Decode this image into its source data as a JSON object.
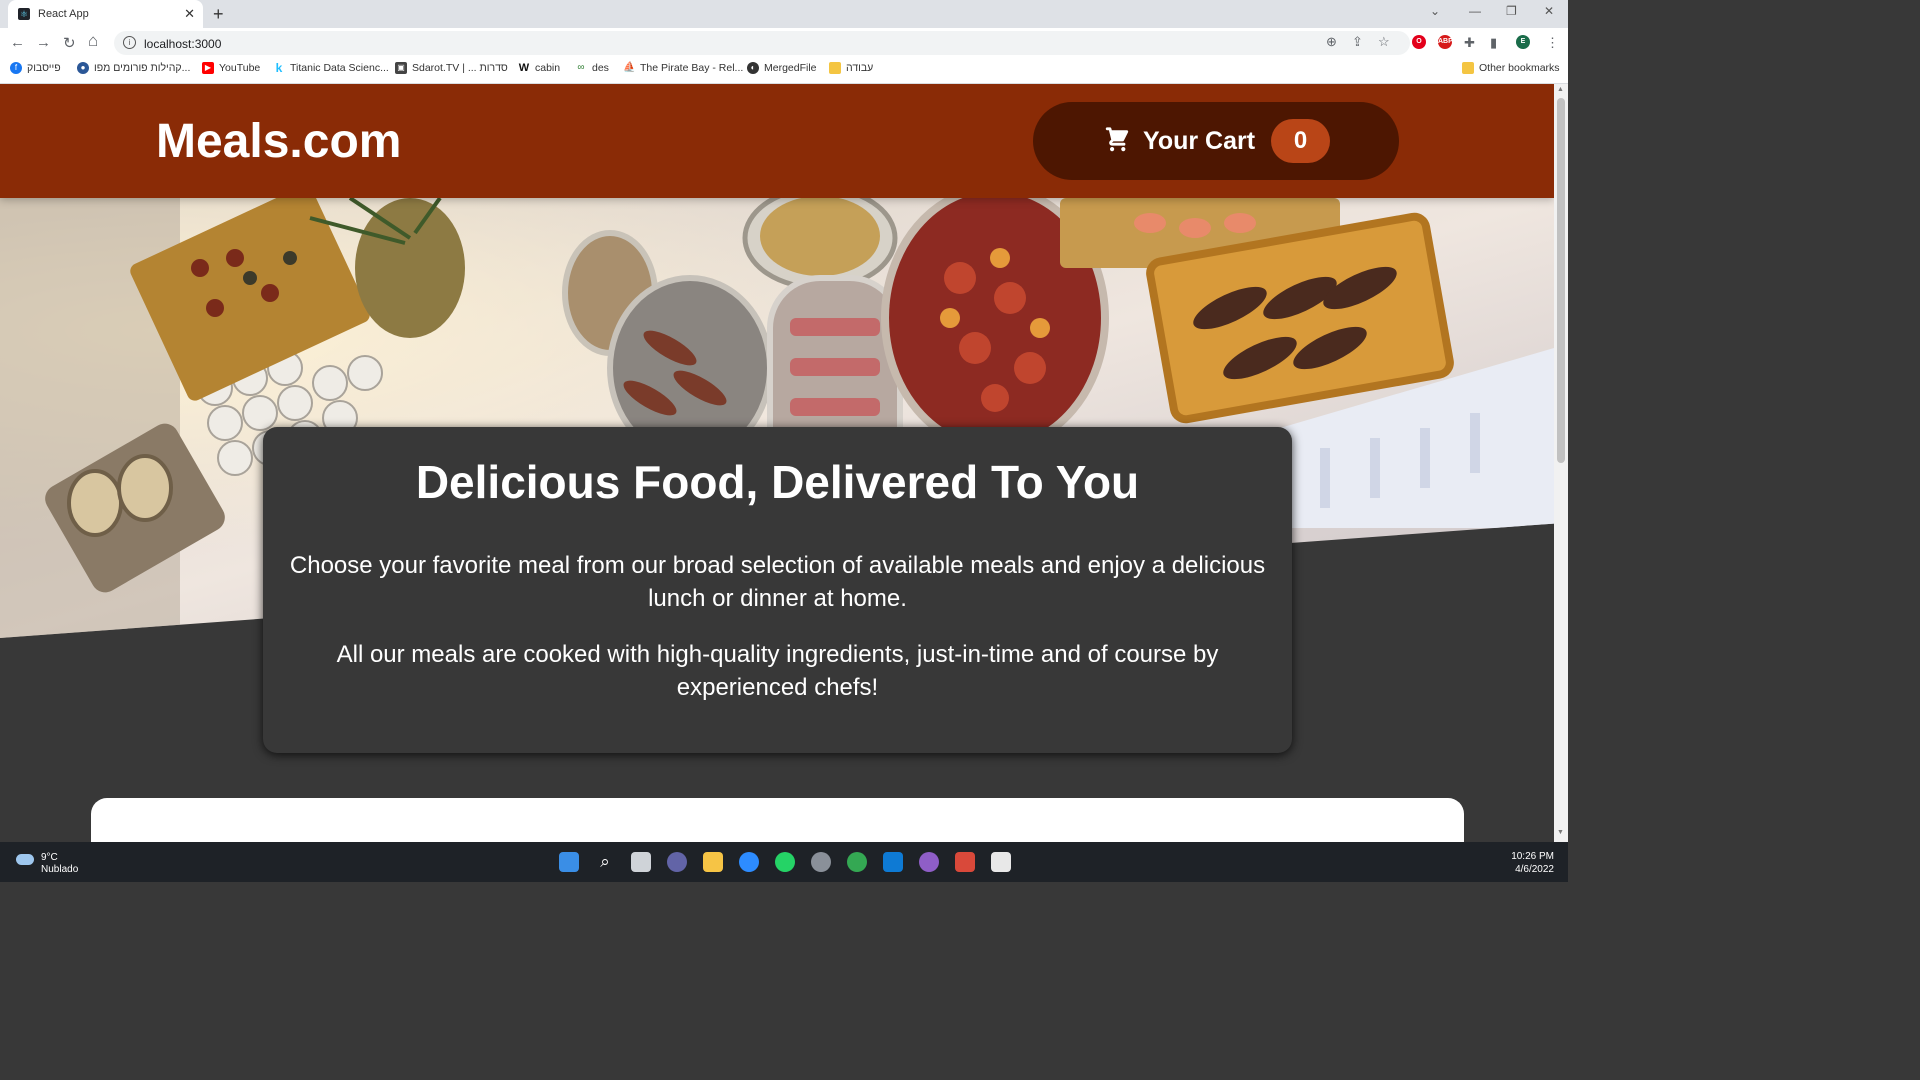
{
  "browser": {
    "tab_title": "React App",
    "tab_close": "✕",
    "new_tab": "+",
    "url": "localhost:3000",
    "nav_back": "←",
    "nav_forward": "→",
    "nav_reload": "↻",
    "nav_home": "⌂",
    "bookmarks": [
      {
        "label": "פייסבוק",
        "icon": "facebook-icon",
        "color": "#1877f2"
      },
      {
        "label": "קהילות פורומים מפו...",
        "icon": "forum-icon",
        "color": "#2b5797"
      },
      {
        "label": "YouTube",
        "icon": "youtube-icon",
        "color": "#ff0000"
      },
      {
        "label": "Titanic Data Scienc...",
        "icon": "kaggle-icon",
        "color": "#20beff"
      },
      {
        "label": "Sdarot.TV | ... סדרות",
        "icon": "sdarot-icon",
        "color": "#444444"
      },
      {
        "label": "cabin",
        "icon": "wikipedia-icon",
        "color": "#111111"
      },
      {
        "label": "des",
        "icon": "des-icon",
        "color": "#2e7d32"
      },
      {
        "label": "The Pirate Bay - Rel...",
        "icon": "pirate-icon",
        "color": "#b5651d"
      },
      {
        "label": "MergedFile",
        "icon": "merged-icon",
        "color": "#333333"
      },
      {
        "label": "עבודה",
        "icon": "folder-icon",
        "color": "#f4c542"
      }
    ],
    "other_bookmarks": "Other bookmarks",
    "profile_initial": "E"
  },
  "header": {
    "logo": "Meals.com",
    "cart_label": "Your Cart",
    "cart_count": "0"
  },
  "summary": {
    "title": "Delicious Food, Delivered To You",
    "paragraph1": "Choose your favorite meal from our broad selection of available meals and enjoy a delicious lunch or dinner at home.",
    "paragraph2": "All our meals are cooked with high-quality ingredients, just-in-time and of course by experienced chefs!"
  },
  "taskbar": {
    "temperature": "9°C",
    "weather": "Nublado",
    "time": "10:26 PM",
    "date": "4/6/2022"
  },
  "colors": {
    "header_bg": "#8a2b06",
    "cart_bg": "#4d1601",
    "badge_bg": "#b94517",
    "page_bg": "#383838"
  }
}
